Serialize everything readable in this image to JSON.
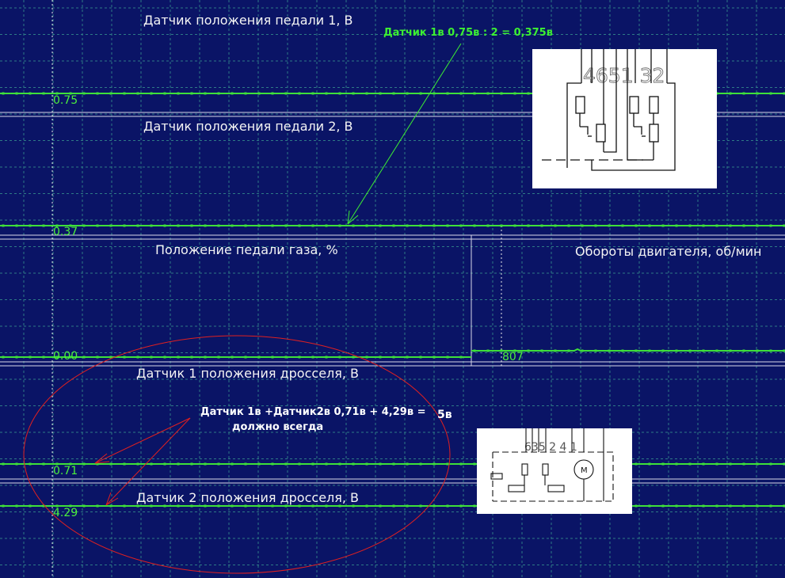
{
  "colors": {
    "background": "#0a1466",
    "grid": "#2e7a86",
    "trace": "#3ee03a",
    "value_text": "#4cf03c",
    "label_text": "#f4f4f4",
    "separator": "#d8d8e8",
    "annotation_green": "#3cf032",
    "annotation_red": "#e02020",
    "note_white": "#ffffff"
  },
  "channels": [
    {
      "label": "Датчик положения педали 1, В",
      "value": "0.75"
    },
    {
      "label": "Датчик положения педали 2, В",
      "value": "0.37"
    },
    {
      "label": "Положение педали газа, %",
      "value": "0.00"
    },
    {
      "label": "Обороты двигателя, об/мин",
      "value": "807"
    },
    {
      "label": "Датчик 1 положения дросселя, В",
      "value": "0.71"
    },
    {
      "label": "Датчик 2 положения дросселя, В",
      "value": "4.29"
    }
  ],
  "annotations": {
    "pedal_note": "Датчик 1в  0,75в : 2 =  0,375в",
    "throttle_note_line1": "Датчик 1в  +Датчик2в  0,71в  +  4,29в =",
    "throttle_note_result": "5в",
    "throttle_note_line2": "должно всегда"
  },
  "pedal_connector": {
    "pins": "4651 32"
  },
  "throttle_connector": {
    "pins": "635 2  4  1",
    "motor_symbol": "M"
  }
}
